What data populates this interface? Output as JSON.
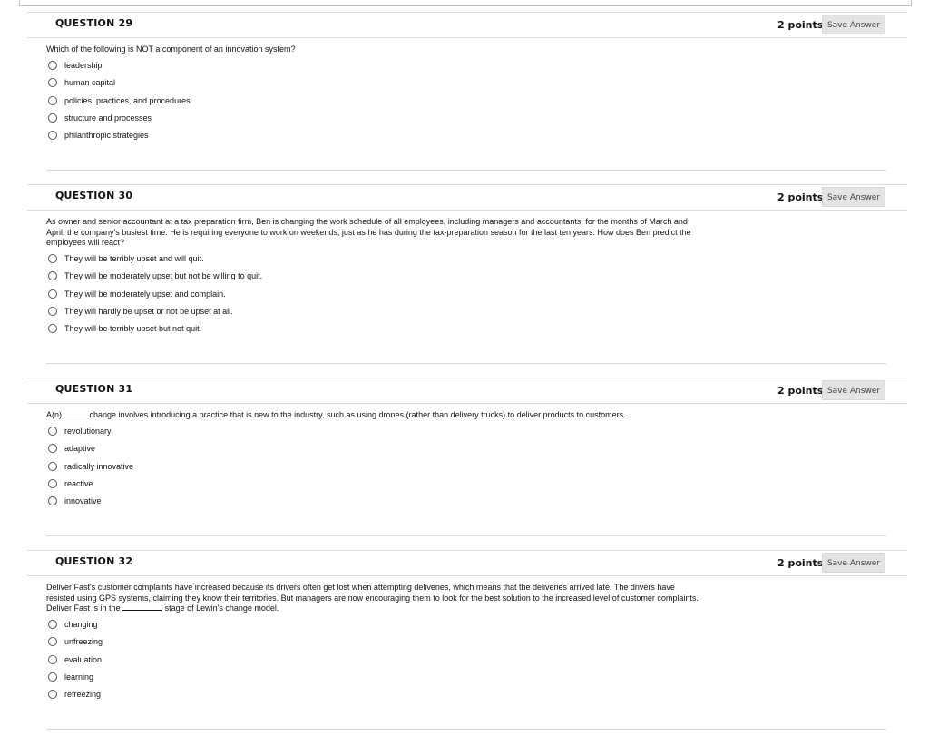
{
  "questions": [
    {
      "title": "QUESTION 29",
      "points": "2 points",
      "save_label": "Save Answer",
      "text": "Which of the following is NOT a component of an innovation system?",
      "options": [
        "leadership",
        "human capital",
        "policies, practices, and procedures",
        "structure and processes",
        "philanthropic strategies"
      ]
    },
    {
      "title": "QUESTION 30",
      "points": "2 points",
      "save_label": "Save Answer",
      "text": "As owner and senior accountant at a tax preparation firm, Ben is changing the work schedule of all employees, including managers and accountants, for the months of March and April, the company's busiest time. He is requiring everyone to work on weekends, just as he has during the tax-preparation season for the last ten years. How does Ben predict the employees will react?",
      "options": [
        "They will be terribly upset and will quit.",
        "They will be moderately upset but not be willing to quit.",
        "They will be moderately upset and complain.",
        "They will hardly be upset or not be upset at all.",
        "They will be terribly upset but not quit."
      ]
    },
    {
      "title": "QUESTION 31",
      "points": "2 points",
      "save_label": "Save Answer",
      "text_before": "A(n)",
      "text_after": "change involves introducing a practice that is new to the industry, such as using drones (rather than delivery trucks) to deliver products to customers.",
      "options": [
        "revolutionary",
        "adaptive",
        "radically innovative",
        "reactive",
        "innovative"
      ]
    },
    {
      "title": "QUESTION 32",
      "points": "2 points",
      "save_label": "Save Answer",
      "text_before": "Deliver Fast's customer complaints have increased because its drivers often get lost when attempting deliveries, which means that the deliveries arrived late. The drivers have resisted using GPS systems, claiming they know their territories. But managers are now encouraging them to look for the best solution to the increased level of customer complaints. Deliver Fast is in the",
      "text_after": "stage of Lewin's change model.",
      "options": [
        "changing",
        "unfreezing",
        "evaluation",
        "learning",
        "refreezing"
      ]
    }
  ]
}
